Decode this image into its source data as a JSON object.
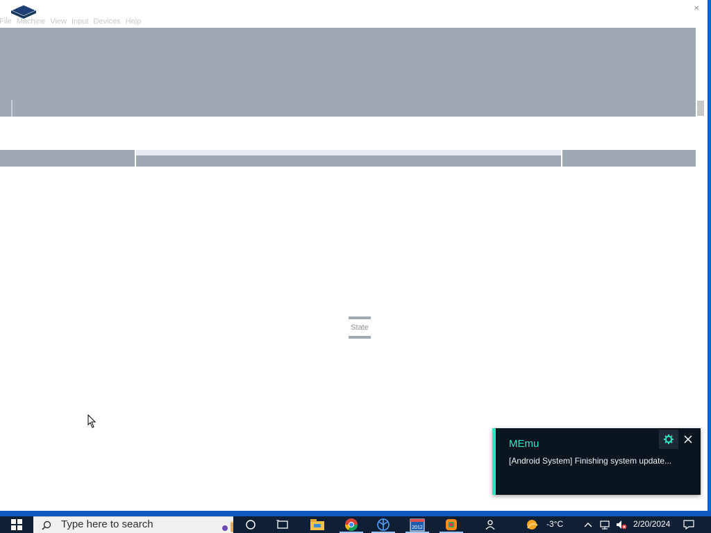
{
  "window": {
    "menu": [
      "File",
      "Machine",
      "View",
      "Input",
      "Devices",
      "Help"
    ]
  },
  "loading": {
    "label": "d State"
  },
  "notification": {
    "app": "MEmu",
    "message": "[Android System] Finishing system update..."
  },
  "taskbar": {
    "search_placeholder": "Type here to search",
    "weather_temp": "-3°C",
    "date": "2/20/2024",
    "icons": [
      "task-view-icon",
      "cortana-icon",
      "file-explorer-icon",
      "chrome-icon",
      "network-app-icon",
      "calendar-2012-icon",
      "memu-icon",
      "people-icon",
      "weather-icon"
    ]
  },
  "colors": {
    "accent_teal": "#2EE6C4",
    "panel_gray": "#A0A8B4",
    "taskbar_bg": "#0F1F35",
    "desktop_blue": "#1876E6"
  }
}
